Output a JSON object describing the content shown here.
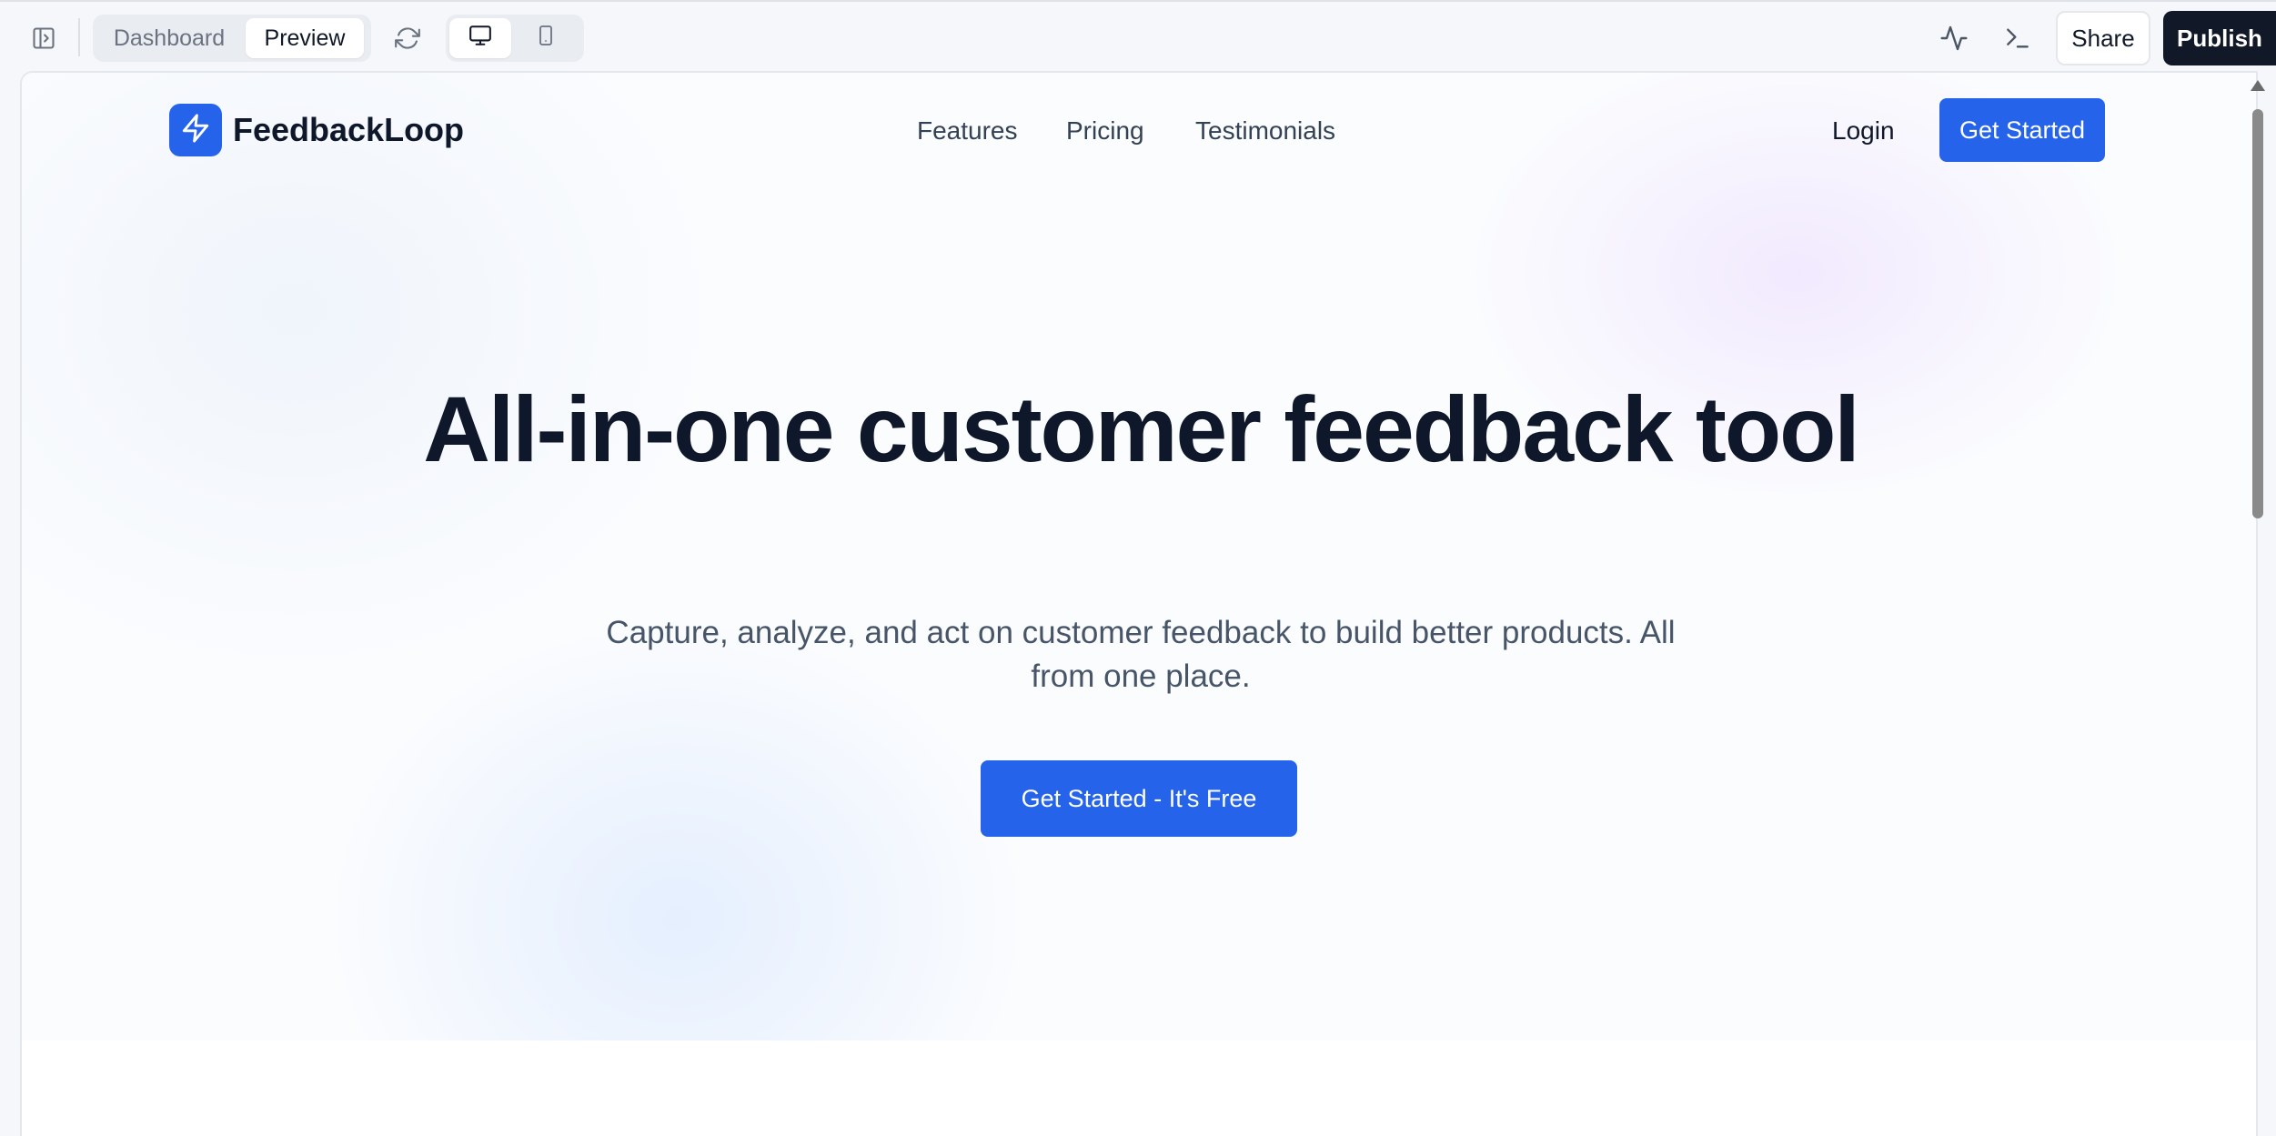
{
  "toolbar": {
    "view_tabs": [
      "Dashboard",
      "Preview"
    ],
    "active_view": "Preview",
    "device_modes": [
      "desktop",
      "mobile"
    ],
    "active_device": "desktop",
    "share_label": "Share",
    "publish_label": "Publish"
  },
  "site": {
    "brand": "FeedbackLoop",
    "nav": [
      "Features",
      "Pricing",
      "Testimonials"
    ],
    "login_label": "Login",
    "nav_cta_label": "Get Started",
    "hero_title": "All-in-one customer feedback tool",
    "hero_subtitle": "Capture, analyze, and act on customer feedback to build better products. All from one place.",
    "hero_cta_label": "Get Started - It's Free"
  },
  "colors": {
    "brand_blue": "#2563eb",
    "publish_bg": "#111827",
    "heading": "#0f172a",
    "subtext": "#475569"
  },
  "icons": {
    "sidebar_toggle": "sidebar-toggle-icon",
    "refresh": "refresh-icon",
    "desktop": "monitor-icon",
    "mobile": "smartphone-icon",
    "activity": "activity-icon",
    "terminal": "terminal-icon",
    "logo": "lightning-bolt-icon"
  }
}
